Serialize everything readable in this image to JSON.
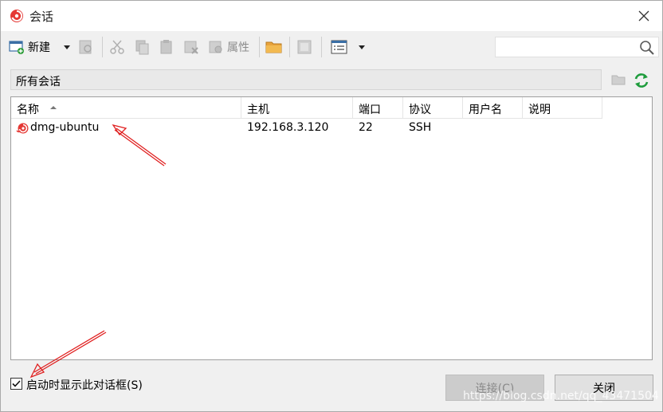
{
  "window": {
    "title": "会话",
    "accent_color": "#e53935"
  },
  "toolbar": {
    "new_label": "新建",
    "properties_label": "属性"
  },
  "search": {
    "placeholder": ""
  },
  "folder": {
    "label": "所有会话"
  },
  "table": {
    "columns": [
      "名称",
      "主机",
      "端口",
      "协议",
      "用户名",
      "说明"
    ],
    "rows": [
      {
        "name": "dmg-ubuntu",
        "host": "192.168.3.120",
        "port": "22",
        "protocol": "SSH",
        "user": "",
        "desc": ""
      }
    ]
  },
  "footer": {
    "show_on_start_label": "启动时显示此对话框(S)",
    "show_on_start_checked": true,
    "connect_label": "连接(C)",
    "close_label": "关闭"
  },
  "watermark": "https://blog.csdn.net/qq_43471504"
}
